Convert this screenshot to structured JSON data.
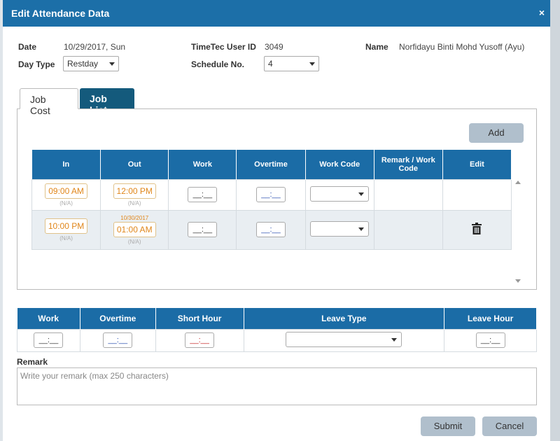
{
  "modal": {
    "title": "Edit Attendance Data",
    "close_label": "×"
  },
  "info": {
    "date_label": "Date",
    "date_value": "10/29/2017, Sun",
    "day_type_label": "Day Type",
    "day_type_value": "Restday",
    "user_id_label": "TimeTec User ID",
    "user_id_value": "3049",
    "schedule_label": "Schedule No.",
    "schedule_value": "4",
    "name_label": "Name",
    "name_value": "Norfidayu Binti Mohd Yusoff (Ayu)"
  },
  "tabs": [
    {
      "label": "Job Cost"
    },
    {
      "label": "Job List"
    }
  ],
  "job": {
    "add_label": "Add",
    "headers": [
      "In",
      "Out",
      "Work",
      "Overtime",
      "Work Code",
      "Remark / Work Code",
      "Edit"
    ],
    "rows": [
      {
        "in_time": "09:00 AM",
        "in_na": "(N/A)",
        "out_date": "",
        "out_time": "12:00 PM",
        "out_na": "(N/A)",
        "work": "__:__",
        "overtime": "__:__"
      },
      {
        "in_time": "10:00 PM",
        "in_na": "(N/A)",
        "out_date": "10/30/2017",
        "out_time": "01:00 AM",
        "out_na": "(N/A)",
        "work": "__:__",
        "overtime": "__:__"
      }
    ]
  },
  "summary": {
    "headers": [
      "Work",
      "Overtime",
      "Short Hour",
      "Leave Type",
      "Leave Hour"
    ],
    "work": "__:__",
    "overtime": "__:__",
    "short_hour": "__:__",
    "leave_hour": "__:__"
  },
  "remark": {
    "label": "Remark",
    "placeholder": "Write your remark (max 250 characters)"
  },
  "buttons": {
    "submit": "Submit",
    "cancel": "Cancel"
  },
  "colors": {
    "header_blue": "#1c6fa8",
    "tab_dark": "#145a7c",
    "time_orange": "#e0861a",
    "button_gray": "#b0bfcc"
  },
  "icons": [
    "close-icon",
    "caret-down-icon",
    "trash-icon",
    "scroll-up-icon",
    "scroll-down-icon"
  ]
}
